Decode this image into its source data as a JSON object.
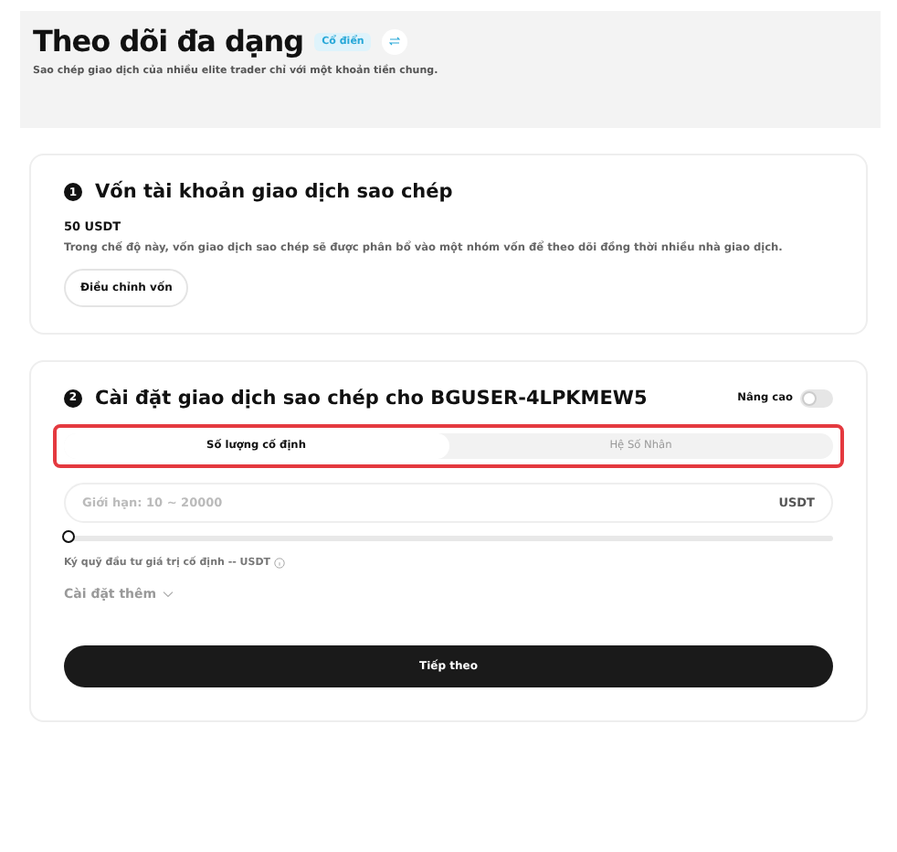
{
  "header": {
    "title": "Theo dõi đa dạng",
    "badge": "Cổ điển",
    "subtitle": "Sao chép giao dịch của nhiều elite trader chỉ với một khoản tiền chung."
  },
  "capital": {
    "step": "1",
    "title": "Vốn tài khoản giao dịch sao chép",
    "amount": "50 USDT",
    "description": "Trong chế độ này, vốn giao dịch sao chép sẽ được phân bổ vào một nhóm vốn để theo dõi đồng thời nhiều nhà giao dịch.",
    "button": "Điều chỉnh vốn"
  },
  "settings": {
    "step": "2",
    "title": "Cài đặt giao dịch sao chép cho BGUSER-4LPKMEW5",
    "advanced": {
      "label": "Nâng cao",
      "on": false
    },
    "tabs_highlighted": true,
    "tabs": [
      {
        "label": "Số lượng cố định",
        "selected": true
      },
      {
        "label": "Hệ Số Nhân",
        "selected": false
      }
    ],
    "amount_field": {
      "placeholder": "Giới hạn: 10 ~ 20000",
      "unit": "USDT"
    },
    "slider": {
      "level": 0
    },
    "margin_note": "Ký quỹ đầu tư giá trị cố định -- USDT",
    "more_settings": "Cài đặt thêm",
    "next_button": "Tiếp theo"
  }
}
